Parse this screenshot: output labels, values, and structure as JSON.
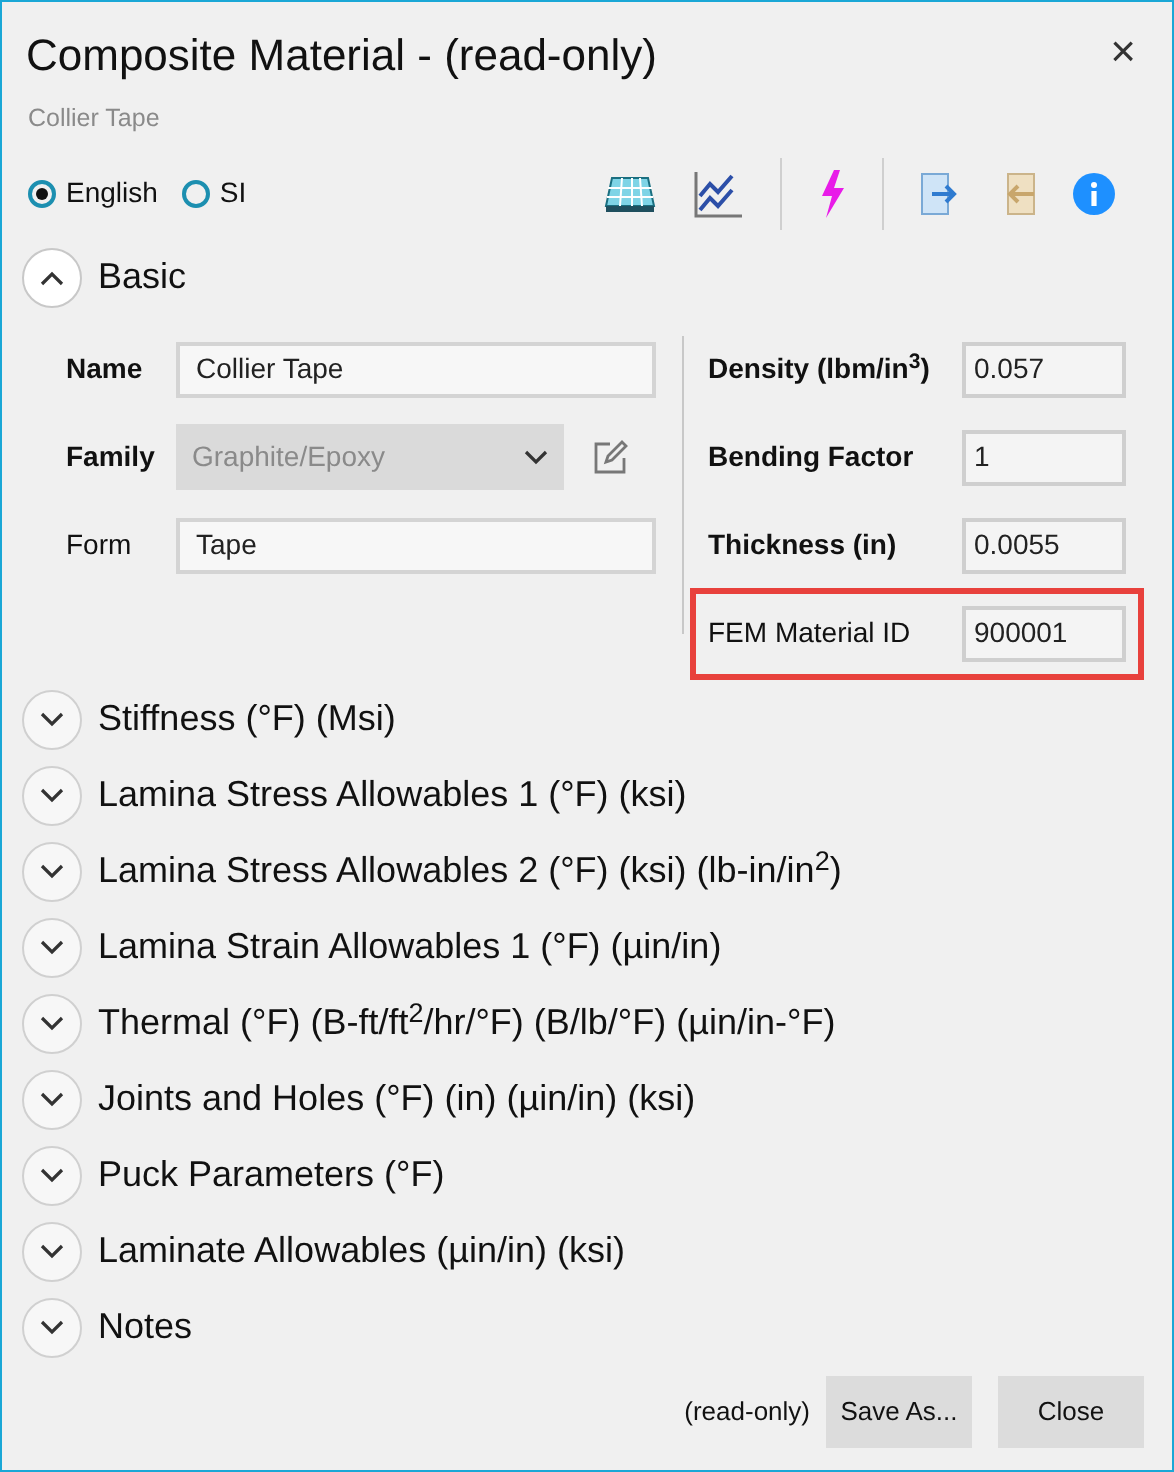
{
  "window": {
    "title": "Composite Material - (read-only)",
    "subtitle": "Collier Tape",
    "close": "×"
  },
  "units": [
    {
      "label": "English",
      "selected": true
    },
    {
      "label": "SI",
      "selected": false
    }
  ],
  "sections": [
    {
      "title": "Basic",
      "expanded": true
    },
    {
      "title": "Stiffness (°F) (Msi)",
      "expanded": false
    },
    {
      "title": "Lamina Stress Allowables 1 (°F) (ksi)",
      "expanded": false
    },
    {
      "title": "Lamina Stress Allowables 2 (°F) (ksi) (lb-in/in$^{2}$)",
      "expanded": false
    },
    {
      "title": "Lamina Strain Allowables 1 (°F) (µin/in)",
      "expanded": false
    },
    {
      "title": "Thermal (°F) (B-ft/ft$^{2}$/hr/°F) (B/lb/°F) (µin/in-°F)",
      "expanded": false
    },
    {
      "title": "Joints and Holes (°F) (in) (µin/in) (ksi)",
      "expanded": false
    },
    {
      "title": "Puck Parameters (°F)",
      "expanded": false
    },
    {
      "title": "Laminate Allowables (µin/in) (ksi)",
      "expanded": false
    },
    {
      "title": "Notes",
      "expanded": false
    }
  ],
  "basic": {
    "left_fields": [
      {
        "label": "Name",
        "bold": true,
        "kind": "text",
        "value": "Collier Tape"
      },
      {
        "label": "Family",
        "bold": true,
        "kind": "dropdown",
        "value": "Graphite/Epoxy",
        "disabled": true
      },
      {
        "label": "Form",
        "bold": false,
        "kind": "text",
        "value": "Tape"
      }
    ],
    "right_fields": [
      {
        "label": "Density (lbm/in$^{3}$)",
        "bold": true,
        "value": "0.057",
        "highlighted": false
      },
      {
        "label": "Bending Factor",
        "bold": true,
        "value": "1",
        "highlighted": false
      },
      {
        "label": "Thickness (in)",
        "bold": true,
        "value": "0.0055",
        "highlighted": false
      },
      {
        "label": "FEM Material ID",
        "bold": false,
        "value": "900001",
        "highlighted": true
      }
    ]
  },
  "footer": {
    "status": "(read-only)",
    "buttons": [
      "Save As...",
      "Close"
    ]
  }
}
